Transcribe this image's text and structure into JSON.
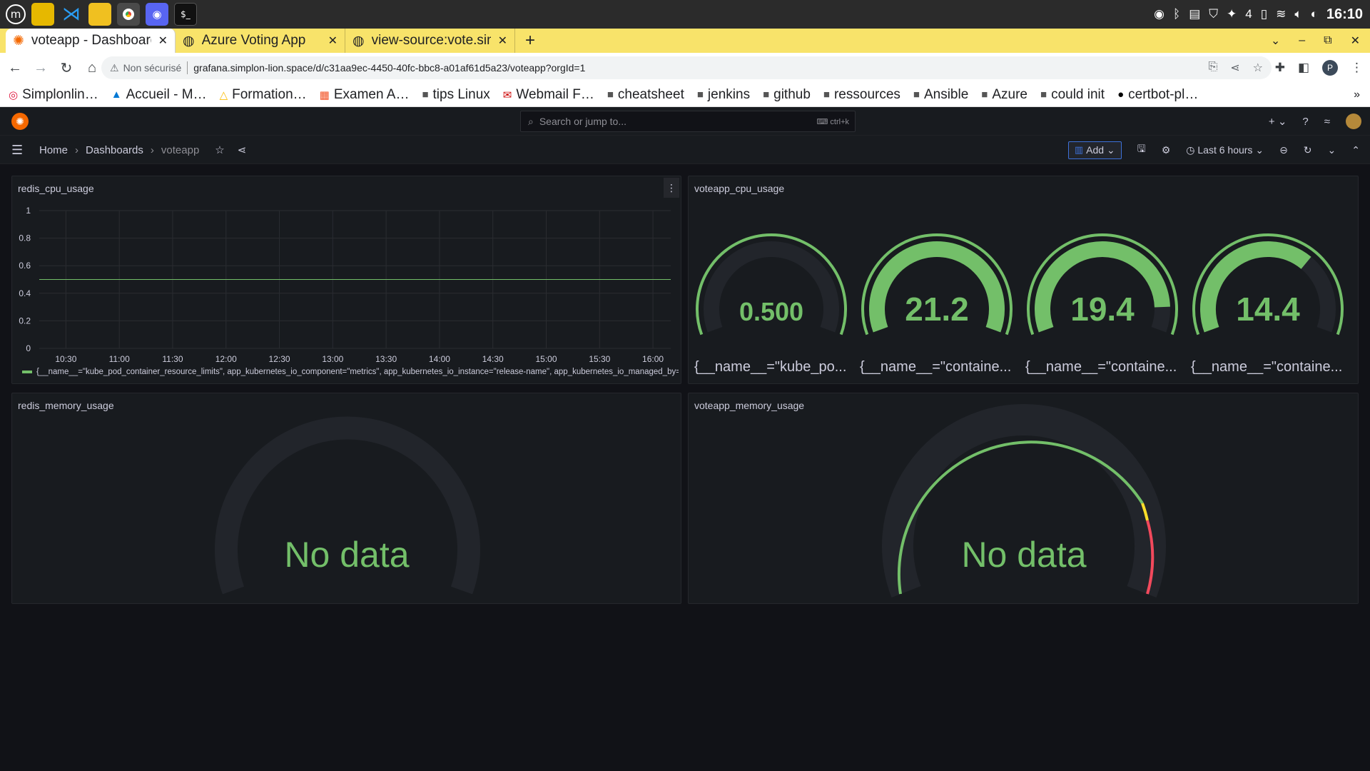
{
  "taskbar": {
    "apps": [
      "mint-menu-icon",
      "file-manager-icon",
      "vscode-icon",
      "folder-icon",
      "chrome-icon",
      "discord-icon",
      "terminal-icon"
    ],
    "tray_count": "4",
    "clock": "16:10"
  },
  "browser": {
    "tabs": [
      {
        "title": "voteapp - Dashboard",
        "active": true
      },
      {
        "title": "Azure Voting App",
        "active": false
      },
      {
        "title": "view-source:vote.sim",
        "active": false
      }
    ],
    "address": {
      "security_label": "Non sécurisé",
      "url": "grafana.simplon-lion.space/d/c31aa9ec-4450-40fc-bbc8-a01af61d5a23/voteapp?orgId=1"
    },
    "profile_initial": "P",
    "bookmarks": [
      "Simplonlin…",
      "Accueil - M…",
      "Formation…",
      "Examen A…",
      "tips Linux",
      "Webmail F…",
      "cheatsheet",
      "jenkins",
      "github",
      "ressources",
      "Ansible",
      "Azure",
      "could init",
      "certbot-pl…"
    ]
  },
  "grafana": {
    "search_placeholder": "Search or jump to...",
    "search_shortcut": "ctrl+k",
    "breadcrumbs": [
      "Home",
      "Dashboards",
      "voteapp"
    ],
    "add_label": "Add",
    "time_range": "Last 6 hours",
    "panels": {
      "redis_cpu": {
        "title": "redis_cpu_usage",
        "legend": "{__name__=\"kube_pod_container_resource_limits\", app_kubernetes_io_component=\"metrics\", app_kubernetes_io_instance=\"release-name\", app_kubernetes_io_managed_by=\"Helm\"}"
      },
      "voteapp_cpu": {
        "title": "voteapp_cpu_usage",
        "gauges": [
          {
            "value": "0.500",
            "label": "{__name__=\"kube_po..."
          },
          {
            "value": "21.2",
            "label": "{__name__=\"containe..."
          },
          {
            "value": "19.4",
            "label": "{__name__=\"containe..."
          },
          {
            "value": "14.4",
            "label": "{__name__=\"containe..."
          }
        ]
      },
      "redis_memory": {
        "title": "redis_memory_usage",
        "no_data": "No data"
      },
      "voteapp_memory": {
        "title": "voteapp_memory_usage",
        "no_data": "No data"
      }
    },
    "colors": {
      "green": "#73bf69",
      "yellow": "#fade2a",
      "red": "#f2495c",
      "track": "#22252b"
    }
  },
  "chart_data": [
    {
      "type": "line",
      "title": "redis_cpu_usage",
      "xlabel": "",
      "ylabel": "",
      "ylim": [
        0,
        1
      ],
      "y_ticks": [
        "0",
        "0.2",
        "0.4",
        "0.6",
        "0.8",
        "1"
      ],
      "x_ticks": [
        "10:30",
        "11:00",
        "11:30",
        "12:00",
        "12:30",
        "13:00",
        "13:30",
        "14:00",
        "14:30",
        "15:00",
        "15:30",
        "16:00"
      ],
      "series": [
        {
          "name": "{__name__=\"kube_pod_container_resource_limits\", app_kubernetes_io_component=\"metrics\", app_kubernetes_io_instance=\"release-name\", app_kubernetes_io_managed_by=\"Helm\"}",
          "x": [
            "10:15",
            "16:10"
          ],
          "values": [
            0.5,
            0.5
          ]
        }
      ],
      "grid": true
    },
    {
      "type": "gauge",
      "title": "voteapp_cpu_usage",
      "gauges": [
        {
          "value": 0.5,
          "fraction": 0.0
        },
        {
          "value": 21.2,
          "fraction": 1.0
        },
        {
          "value": 19.4,
          "fraction": 0.9
        },
        {
          "value": 14.4,
          "fraction": 0.68
        }
      ]
    }
  ]
}
